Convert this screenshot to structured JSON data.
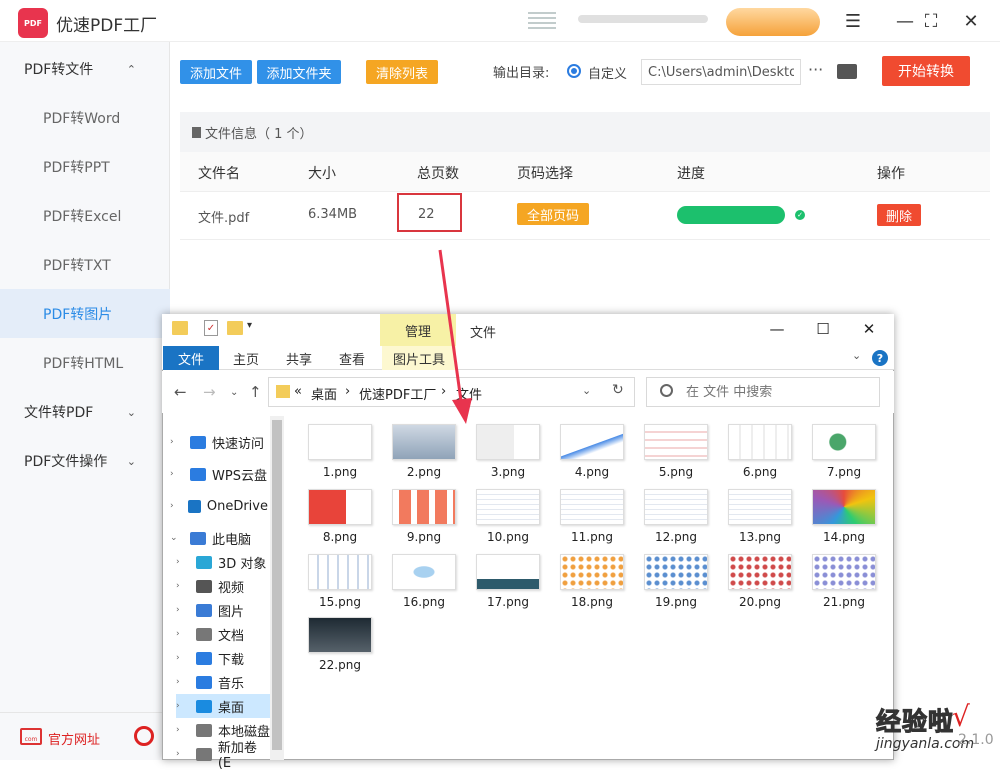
{
  "app": {
    "logo_text": "PDF",
    "title": "优速PDF工厂"
  },
  "sidebar": {
    "groups": [
      {
        "label": "PDF转文件"
      },
      {
        "label": "文件转PDF"
      },
      {
        "label": "PDF文件操作"
      }
    ],
    "items": [
      {
        "label": "PDF转Word"
      },
      {
        "label": "PDF转PPT"
      },
      {
        "label": "PDF转Excel"
      },
      {
        "label": "PDF转TXT"
      },
      {
        "label": "PDF转图片",
        "active": true
      },
      {
        "label": "PDF转HTML"
      }
    ],
    "footer": {
      "website_label": "官方网址",
      "website_icon_text": "com"
    }
  },
  "toolbar": {
    "add_file": "添加文件",
    "add_folder": "添加文件夹",
    "clear_list": "清除列表",
    "output_label": "输出目录:",
    "radio_label": "自定义",
    "output_path": "C:\\Users\\admin\\Deskto",
    "more": "···",
    "start": "开始转换"
  },
  "file_info": {
    "title": "文件信息（ 1 个）"
  },
  "table": {
    "headers": [
      "文件名",
      "大小",
      "总页数",
      "页码选择",
      "进度",
      "操作"
    ],
    "rows": [
      {
        "name": "文件.pdf",
        "size": "6.34MB",
        "pages": "22",
        "page_select": "全部页码",
        "progress": 1.0,
        "action": "删除"
      }
    ]
  },
  "explorer": {
    "manage_tab": "管理",
    "window_title": "文件",
    "ribbon_tabs": [
      "文件",
      "主页",
      "共享",
      "查看",
      "图片工具"
    ],
    "breadcrumb": [
      "«",
      "桌面",
      "›",
      "优速PDF工厂",
      "›",
      "文件"
    ],
    "search_placeholder": "在 文件 中搜索",
    "nav": [
      {
        "label": "快速访问",
        "icon": "star-icon"
      },
      {
        "label": "WPS云盘",
        "icon": "cloud-icon"
      },
      {
        "label": "OneDrive",
        "icon": "onedrive-icon"
      },
      {
        "label": "此电脑",
        "icon": "computer-icon"
      },
      {
        "label": "3D 对象",
        "icon": "cube-icon"
      },
      {
        "label": "视频",
        "icon": "video-icon"
      },
      {
        "label": "图片",
        "icon": "picture-icon"
      },
      {
        "label": "文档",
        "icon": "document-icon"
      },
      {
        "label": "下载",
        "icon": "download-icon"
      },
      {
        "label": "音乐",
        "icon": "music-icon"
      },
      {
        "label": "桌面",
        "icon": "desktop-icon"
      },
      {
        "label": "本地磁盘",
        "icon": "disk-icon"
      },
      {
        "label": "新加卷 (E",
        "icon": "disk-icon"
      }
    ],
    "files": [
      "1.png",
      "2.png",
      "3.png",
      "4.png",
      "5.png",
      "6.png",
      "7.png",
      "8.png",
      "9.png",
      "10.png",
      "11.png",
      "12.png",
      "13.png",
      "14.png",
      "15.png",
      "16.png",
      "17.png",
      "18.png",
      "19.png",
      "20.png",
      "21.png",
      "22.png"
    ]
  },
  "watermark": {
    "text": "经验啦",
    "check": "√",
    "url": "jingyanla.com",
    "version": "2.1.0"
  },
  "colors": {
    "accent": "#3191e8",
    "orange": "#f5a623",
    "red": "#f04b30",
    "green": "#1cc06d",
    "highlight": "#d9363e"
  }
}
